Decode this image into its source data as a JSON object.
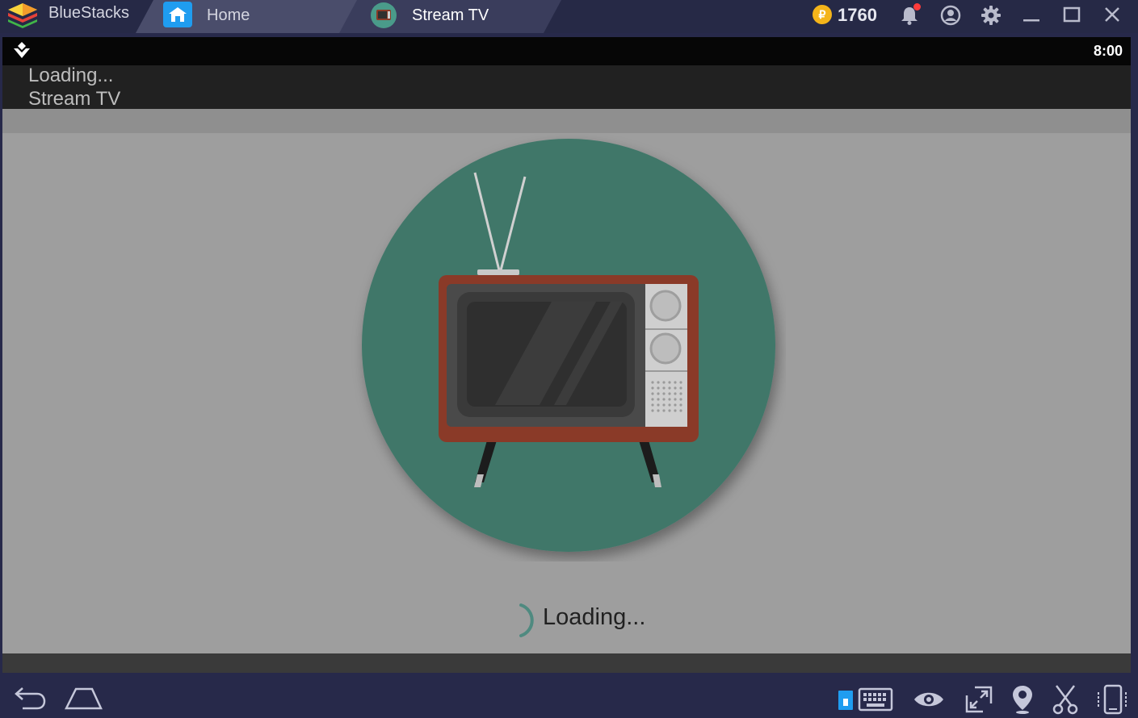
{
  "window": {
    "brand": "BlueStacks",
    "tabs": [
      {
        "label": "Home",
        "icon": "home-icon"
      },
      {
        "label": "Stream TV",
        "icon": "tv-icon"
      }
    ],
    "coins": "1760",
    "controls": [
      "bell-icon",
      "account-icon",
      "gear-icon",
      "minimize-icon",
      "maximize-icon",
      "close-icon"
    ]
  },
  "android": {
    "status_time": "8:00",
    "header": {
      "line1": "Loading...",
      "line2": "Stream TV"
    },
    "loading_text": "Loading...",
    "colors": {
      "circle": "#3f7769",
      "tv_body": "#8a3a28",
      "screen": "#303030",
      "panel": "#cfcfcf"
    }
  },
  "bottom_bar": {
    "left": [
      "back-icon",
      "home-icon"
    ],
    "right": [
      "keyboard-icon",
      "eye-icon",
      "fullscreen-icon",
      "location-icon",
      "scissors-icon",
      "rotate-icon"
    ]
  }
}
